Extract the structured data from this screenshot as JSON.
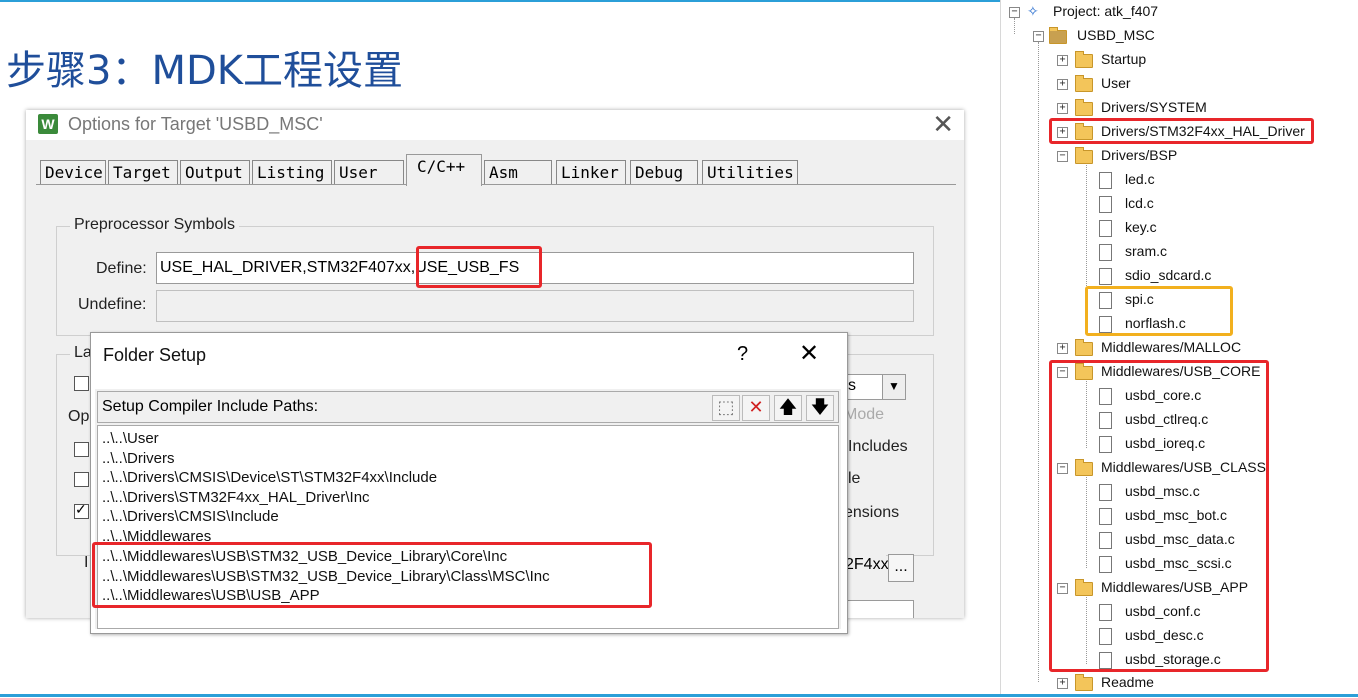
{
  "slide": {
    "title": "步骤3：MDK工程设置"
  },
  "options_dialog": {
    "title": "Options for Target 'USBD_MSC'",
    "logo": "W",
    "close_glyph": "✕",
    "tabs": [
      "Device",
      "Target",
      "Output",
      "Listing",
      "User",
      "C/C++",
      "Asm",
      "Linker",
      "Debug",
      "Utilities"
    ],
    "active_tab": "C/C++",
    "preprocessor": {
      "group_label": "Preprocessor Symbols",
      "define_label": "Define:",
      "define_value_part1": "USE_HAL_DRIVER,STM32F407xx,",
      "define_value_part2": "USE_USB_FS",
      "undefine_label": "Undefine:",
      "undefine_value": ""
    },
    "partial": {
      "language_label": "La",
      "optimization_label": "Op",
      "include_label": "I",
      "mode_text": "Mode",
      "includes_text": "Includes",
      "le_text": "le",
      "ensions_text": "ensions",
      "f4xx_text": "2F4xx",
      "browse_btn": "...",
      "combo_text": "s",
      "combo_arrow": "▼"
    }
  },
  "folder_setup": {
    "title": "Folder Setup",
    "help_glyph": "?",
    "close_glyph": "✕",
    "bar_label": "Setup Compiler Include Paths:",
    "toolbar": {
      "new_glyph": "⬚",
      "delete_glyph": "✕",
      "up_glyph": "🡅",
      "down_glyph": "🡇"
    },
    "paths": [
      "..\\..\\User",
      "..\\..\\Drivers",
      "..\\..\\Drivers\\CMSIS\\Device\\ST\\STM32F4xx\\Include",
      "..\\..\\Drivers\\STM32F4xx_HAL_Driver\\Inc",
      "..\\..\\Drivers\\CMSIS\\Include",
      "..\\..\\Middlewares",
      "..\\..\\Middlewares\\USB\\STM32_USB_Device_Library\\Core\\Inc",
      "..\\..\\Middlewares\\USB\\STM32_USB_Device_Library\\Class\\MSC\\Inc",
      "..\\..\\Middlewares\\USB\\USB_APP"
    ]
  },
  "project_tree": {
    "project": "Project: atk_f407",
    "target": "USBD_MSC",
    "groups": {
      "startup": "Startup",
      "user": "User",
      "drivers_system": "Drivers/SYSTEM",
      "drivers_hal": "Drivers/STM32F4xx_HAL_Driver",
      "drivers_bsp": "Drivers/BSP",
      "bsp_files": [
        "led.c",
        "lcd.c",
        "key.c",
        "sram.c",
        "sdio_sdcard.c",
        "spi.c",
        "norflash.c"
      ],
      "malloc": "Middlewares/MALLOC",
      "usb_core": "Middlewares/USB_CORE",
      "usb_core_files": [
        "usbd_core.c",
        "usbd_ctlreq.c",
        "usbd_ioreq.c"
      ],
      "usb_class": "Middlewares/USB_CLASS",
      "usb_class_files": [
        "usbd_msc.c",
        "usbd_msc_bot.c",
        "usbd_msc_data.c",
        "usbd_msc_scsi.c"
      ],
      "usb_app": "Middlewares/USB_APP",
      "usb_app_files": [
        "usbd_conf.c",
        "usbd_desc.c",
        "usbd_storage.c"
      ],
      "readme": "Readme"
    },
    "expander_plus": "+",
    "expander_minus": "−"
  },
  "colors": {
    "highlight_red": "#e8262a",
    "highlight_yellow": "#f2b01e",
    "title_blue": "#1f4e9a",
    "frame_blue": "#2b9fd8"
  }
}
